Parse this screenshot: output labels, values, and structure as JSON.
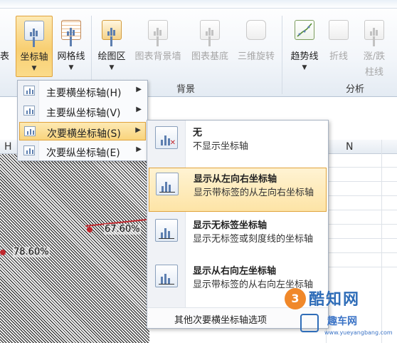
{
  "ribbon": {
    "partial_label_left": "表",
    "buttons": [
      {
        "label": "坐标轴",
        "state": "pressed"
      },
      {
        "label": "网格线",
        "state": "normal"
      },
      {
        "label": "绘图区",
        "state": "normal"
      },
      {
        "label": "图表背景墙",
        "state": "disabled"
      },
      {
        "label": "图表基底",
        "state": "disabled"
      },
      {
        "label": "三维旋转",
        "state": "disabled"
      },
      {
        "label": "趋势线",
        "state": "normal"
      },
      {
        "label": "折线",
        "state": "disabled"
      },
      {
        "label": "涨/跌",
        "label_line2": "柱线",
        "state": "disabled"
      }
    ],
    "groups": {
      "background": "背景",
      "analysis": "分析"
    }
  },
  "axis_menu": {
    "items": [
      {
        "label": "主要横坐标轴(H)"
      },
      {
        "label": "主要纵坐标轴(V)"
      },
      {
        "label": "次要横坐标轴(S)",
        "active": true
      },
      {
        "label": "次要纵坐标轴(E)"
      }
    ]
  },
  "sub_menu": {
    "options": [
      {
        "title": "无",
        "desc": "不显示坐标轴"
      },
      {
        "title": "显示从左向右坐标轴",
        "desc": "显示带标签的从左向右坐标轴",
        "active": true
      },
      {
        "title": "显示无标签坐标轴",
        "desc": "显示无标签或刻度线的坐标轴"
      },
      {
        "title": "显示从右向左坐标轴",
        "desc": "显示带标签的从右向左坐标轴"
      }
    ],
    "footer": "其他次要横坐标轴选项"
  },
  "sheet": {
    "columns": [
      "H",
      "N"
    ]
  },
  "chart": {
    "labels": [
      "67.60%",
      "78.60%"
    ]
  },
  "watermark": {
    "badge": "3",
    "brand": "酷知网",
    "brand2": "趣车网",
    "url": "www.yueyangbang.com"
  },
  "colors": {
    "pressed": "#f8cf72",
    "accent_border": "#e0a33c",
    "series": "#c0282e"
  }
}
